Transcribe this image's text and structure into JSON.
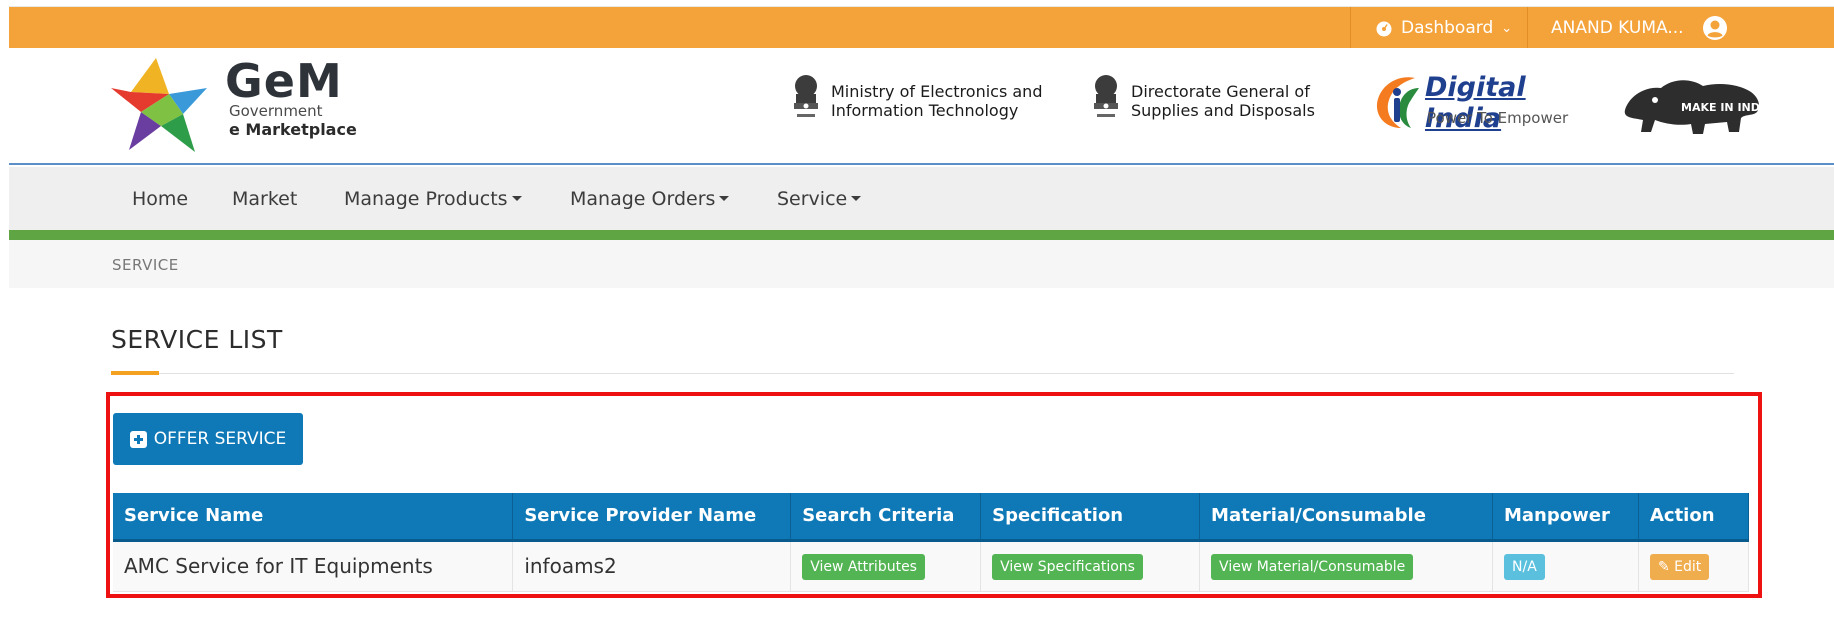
{
  "topbar": {
    "dashboard_label": "Dashboard",
    "user_label": "ANAND KUMA..."
  },
  "header": {
    "logo": {
      "title": "GeM",
      "line1": "Government",
      "line2": "e Marketplace"
    },
    "partners": [
      {
        "text": "Ministry of Electronics and\nInformation Technology"
      },
      {
        "text": "Directorate General of\nSupplies and Disposals"
      }
    ],
    "digital_india": {
      "title": "Digital India",
      "tagline": "Power To Empower"
    },
    "make_in_india_text": "MAKE IN INDIA"
  },
  "nav": {
    "items": [
      {
        "label": "Home",
        "has_dropdown": false
      },
      {
        "label": "Market",
        "has_dropdown": false
      },
      {
        "label": "Manage Products",
        "has_dropdown": true
      },
      {
        "label": "Manage Orders",
        "has_dropdown": true
      },
      {
        "label": "Service",
        "has_dropdown": true
      }
    ]
  },
  "breadcrumb": "SERVICE",
  "page_title": "SERVICE LIST",
  "offer_button_label": "OFFER SERVICE",
  "table": {
    "columns": [
      "Service Name",
      "Service Provider Name",
      "Search Criteria",
      "Specification",
      "Material/Consumable",
      "Manpower",
      "Action"
    ],
    "rows": [
      {
        "service_name": "AMC Service for IT Equipments",
        "provider": "infoams2",
        "search_criteria_btn": "View Attributes",
        "specification_btn": "View Specifications",
        "material_btn": "View Material/Consumable",
        "manpower": "N/A",
        "action_btn": "Edit"
      }
    ]
  },
  "colors": {
    "topbar": "#f4a23a",
    "primary_blue": "#0f79b7",
    "nav_green": "#5fa544",
    "highlight_red": "#ee1111"
  }
}
